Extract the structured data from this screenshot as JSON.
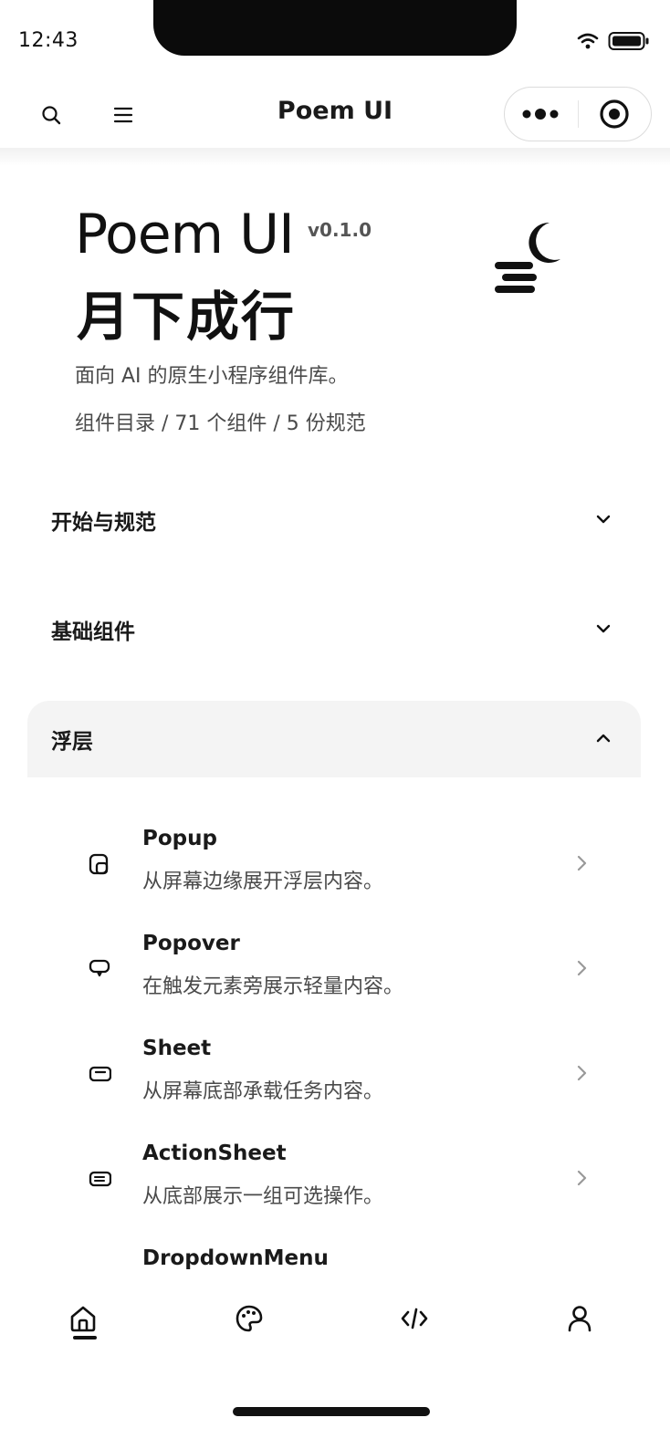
{
  "status_bar": {
    "time": "12:43"
  },
  "nav": {
    "title": "Poem UI"
  },
  "hero": {
    "title": "Poem UI",
    "version": "v0.1.0",
    "subtitle": "月下成行",
    "description": "面向 AI 的原生小程序组件库。",
    "stats": "组件目录 / 71 个组件 / 5 份规范"
  },
  "sections": [
    {
      "label": "开始与规范",
      "expanded": false
    },
    {
      "label": "基础组件",
      "expanded": false
    },
    {
      "label": "浮层",
      "expanded": true
    }
  ],
  "overlay_items": [
    {
      "title": "Popup",
      "desc": "从屏幕边缘展开浮层内容。",
      "icon": "popup-icon"
    },
    {
      "title": "Popover",
      "desc": "在触发元素旁展示轻量内容。",
      "icon": "popover-icon"
    },
    {
      "title": "Sheet",
      "desc": "从屏幕底部承载任务内容。",
      "icon": "sheet-icon"
    },
    {
      "title": "ActionSheet",
      "desc": "从底部展示一组可选操作。",
      "icon": "action-sheet-icon"
    },
    {
      "title": "DropdownMenu",
      "desc": "",
      "icon": "dropdown-menu-icon"
    }
  ],
  "tabbar": {
    "items": [
      "home-icon",
      "palette-icon",
      "code-icon",
      "user-icon"
    ],
    "active": 0
  },
  "colors": {
    "text": "#1a1a1a",
    "muted": "#4a4a4a",
    "section_bg": "#f4f4f4",
    "accent": "#111111"
  }
}
